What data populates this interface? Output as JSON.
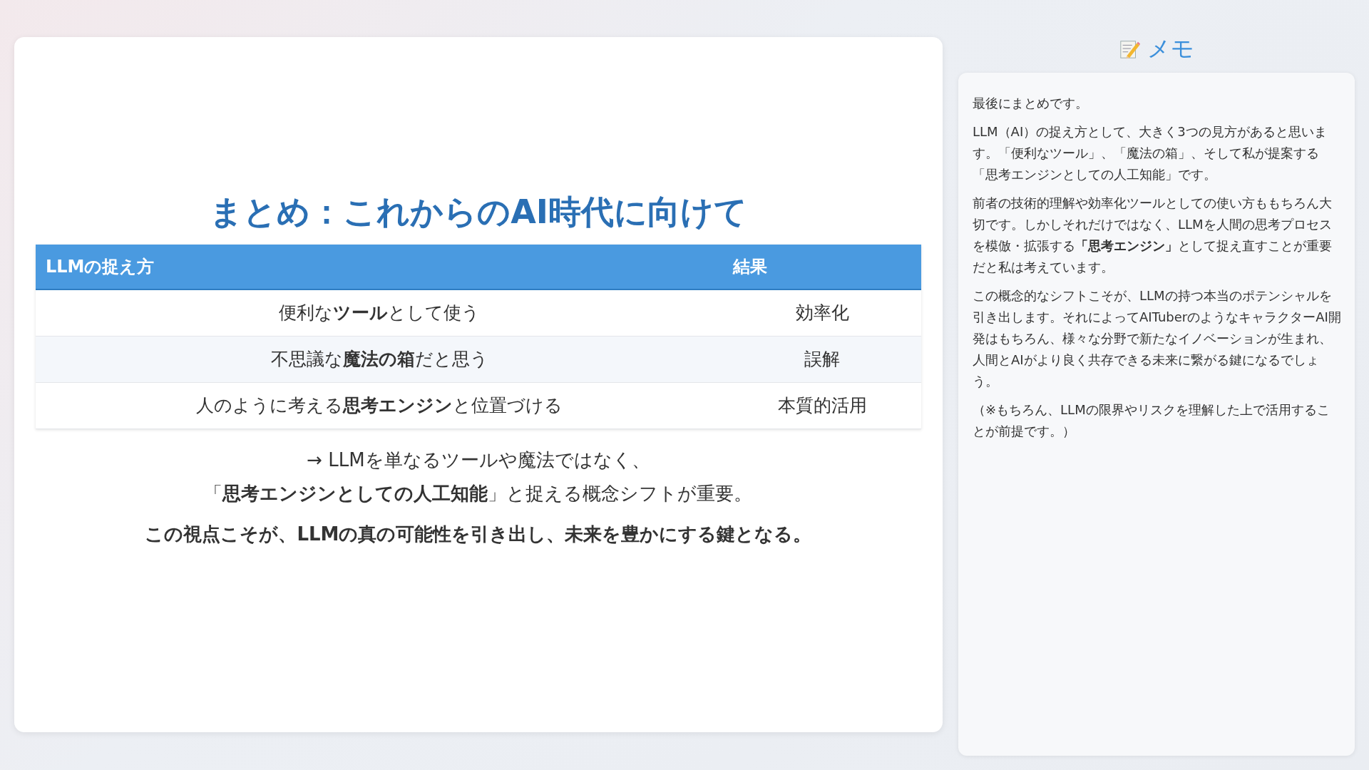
{
  "slide": {
    "title": "まとめ：これからのAI時代に向けて",
    "table": {
      "columns": [
        "LLMの捉え方",
        "結果"
      ],
      "rows": [
        {
          "cells": [
            "便利な**ツール**として使う",
            "効率化"
          ]
        },
        {
          "cells": [
            "不思議な**魔法の箱**だと思う",
            "誤解"
          ]
        },
        {
          "cells": [
            "人のように考える**思考エンジン**と位置づける",
            "本質的活用"
          ]
        }
      ]
    },
    "conclusion": [
      {
        "kind": "normal",
        "text": "→ LLMを単なるツールや魔法ではなく、"
      },
      {
        "kind": "normal",
        "text": "「**思考エンジンとしての人工知能**」と捉える概念シフトが重要。"
      },
      {
        "kind": "emphasis",
        "text": "この視点こそが、LLMの真の可能性を引き出し、未来を豊かにする鍵となる。"
      }
    ]
  },
  "notes": {
    "title": "メモ",
    "paragraphs": [
      "最後にまとめです。",
      "LLM（AI）の捉え方として、大きく3つの見方があると思います。「便利なツール」、「魔法の箱」、そして私が提案する「思考エンジンとしての人工知能」です。",
      "前者の技術的理解や効率化ツールとしての使い方ももちろん大切です。しかしそれだけではなく、LLMを人間の思考プロセスを模倣・拡張する**「思考エンジン」**として捉え直すことが重要だと私は考えています。",
      "この概念的なシフトこそが、LLMの持つ本当のポテンシャルを引き出します。それによってAITuberのようなキャラクターAI開発はもちろん、様々な分野で新たなイノベーションが生まれ、人間とAIがより良く共存できる未来に繋がる鍵になるでしょう。",
      "（※もちろん、LLMの限界やリスクを理解した上で活用することが前提です。）"
    ]
  }
}
